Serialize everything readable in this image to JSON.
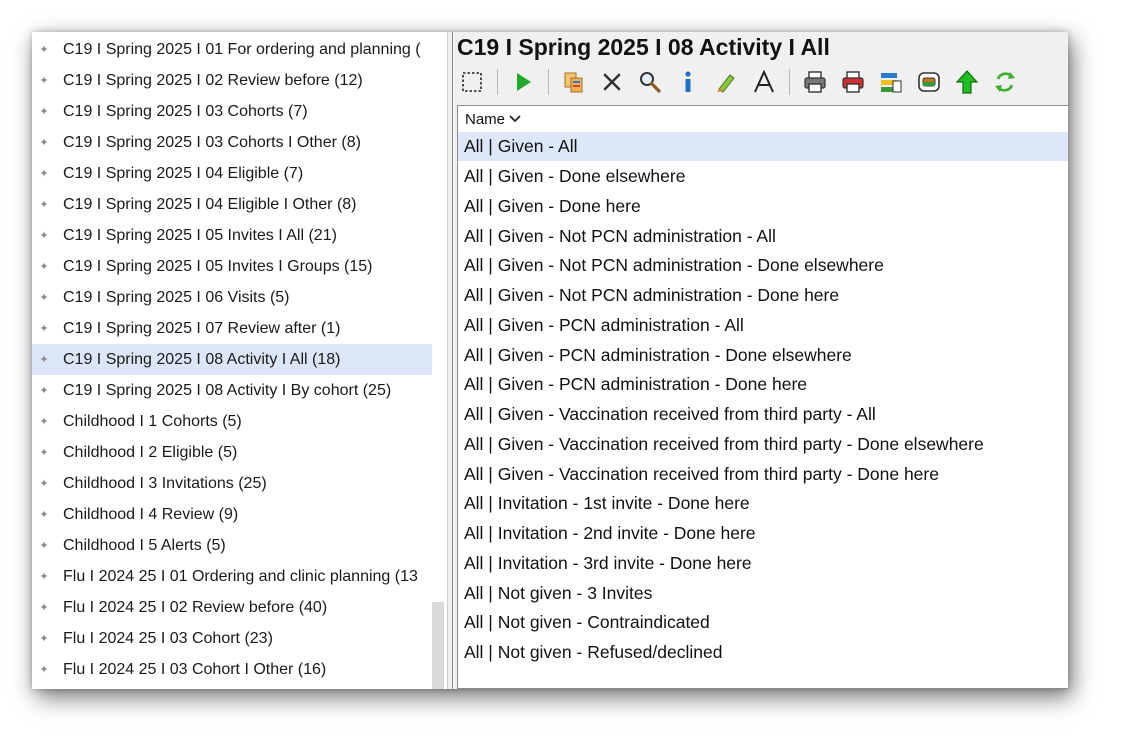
{
  "tree": {
    "items": [
      {
        "label": "C19 I Spring 2025 I 01 For ordering and planning (",
        "selected": false
      },
      {
        "label": "C19 I Spring 2025 I 02 Review before (12)",
        "selected": false
      },
      {
        "label": "C19 I Spring 2025 I 03 Cohorts (7)",
        "selected": false
      },
      {
        "label": "C19 I Spring 2025 I 03 Cohorts I Other (8)",
        "selected": false
      },
      {
        "label": "C19 I Spring 2025 I 04 Eligible (7)",
        "selected": false
      },
      {
        "label": "C19 I Spring 2025 I 04 Eligible I Other (8)",
        "selected": false
      },
      {
        "label": "C19 I Spring 2025 I 05 Invites I All (21)",
        "selected": false
      },
      {
        "label": "C19 I Spring 2025 I 05 Invites I Groups (15)",
        "selected": false
      },
      {
        "label": "C19 I Spring 2025 I 06 Visits (5)",
        "selected": false
      },
      {
        "label": "C19 I Spring 2025 I 07 Review after (1)",
        "selected": false
      },
      {
        "label": "C19 I Spring 2025 I 08 Activity I All (18)",
        "selected": true
      },
      {
        "label": "C19 I Spring 2025 I 08 Activity I By cohort (25)",
        "selected": false
      },
      {
        "label": "Childhood I 1 Cohorts (5)",
        "selected": false
      },
      {
        "label": "Childhood I 2 Eligible (5)",
        "selected": false
      },
      {
        "label": "Childhood I 3 Invitations (25)",
        "selected": false
      },
      {
        "label": "Childhood I 4 Review (9)",
        "selected": false
      },
      {
        "label": "Childhood I 5 Alerts (5)",
        "selected": false
      },
      {
        "label": "Flu I 2024 25 I 01 Ordering and clinic planning (13",
        "selected": false
      },
      {
        "label": "Flu I 2024 25 I 02 Review before (40)",
        "selected": false
      },
      {
        "label": "Flu I 2024 25 I 03 Cohort (23)",
        "selected": false
      },
      {
        "label": "Flu I 2024 25 I 03 Cohort I Other (16)",
        "selected": false
      }
    ]
  },
  "panel": {
    "title": "C19 I Spring 2025 I 08 Activity I All",
    "column_header": "Name",
    "toolbar_icons": [
      "select-icon",
      "run-icon",
      "copy-icon",
      "delete-icon",
      "search-icon",
      "info-icon",
      "highlight-icon",
      "font-icon",
      "print-icon",
      "print-red-icon",
      "report-icon",
      "export-icon",
      "up-arrow-icon",
      "refresh-icon"
    ]
  },
  "rows": [
    {
      "label": "All | Given - All",
      "selected": true
    },
    {
      "label": "All | Given - Done elsewhere",
      "selected": false
    },
    {
      "label": "All | Given - Done here",
      "selected": false
    },
    {
      "label": "All | Given - Not PCN administration - All",
      "selected": false
    },
    {
      "label": "All | Given - Not PCN administration - Done elsewhere",
      "selected": false
    },
    {
      "label": "All | Given - Not PCN administration - Done here",
      "selected": false
    },
    {
      "label": "All | Given - PCN administration - All",
      "selected": false
    },
    {
      "label": "All | Given - PCN administration - Done elsewhere",
      "selected": false
    },
    {
      "label": "All | Given - PCN administration - Done here",
      "selected": false
    },
    {
      "label": "All | Given - Vaccination received from third party - All",
      "selected": false
    },
    {
      "label": "All | Given - Vaccination received from third party - Done elsewhere",
      "selected": false
    },
    {
      "label": "All | Given - Vaccination received from third party - Done here",
      "selected": false
    },
    {
      "label": "All | Invitation - 1st invite - Done here",
      "selected": false
    },
    {
      "label": "All | Invitation - 2nd invite - Done here",
      "selected": false
    },
    {
      "label": "All | Invitation - 3rd invite - Done here",
      "selected": false
    },
    {
      "label": "All | Not given - 3 Invites",
      "selected": false
    },
    {
      "label": "All | Not given - Contraindicated",
      "selected": false
    },
    {
      "label": "All | Not given - Refused/declined",
      "selected": false
    }
  ],
  "colors": {
    "selection": "#dbe7f8",
    "run_green": "#22a82a",
    "info_blue": "#1f6fc4"
  }
}
